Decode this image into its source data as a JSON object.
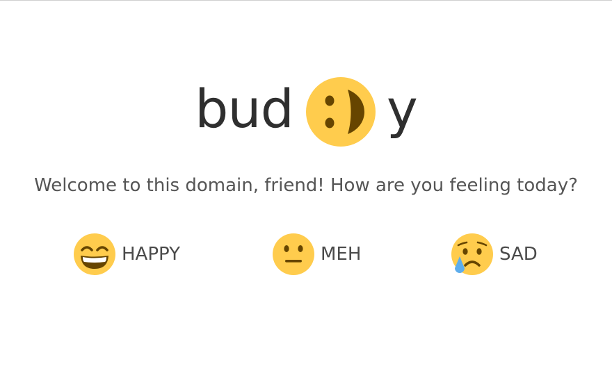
{
  "logo": {
    "left_text": "bud",
    "right_text": "y",
    "face_icon": "winking-smile-face-icon"
  },
  "greeting": "Welcome to this domain, friend! How are you feeling today?",
  "moods": [
    {
      "label": "HAPPY",
      "icon": "grinning-face-icon"
    },
    {
      "label": "MEH",
      "icon": "neutral-face-icon"
    },
    {
      "label": "SAD",
      "icon": "crying-face-icon"
    }
  ],
  "colors": {
    "face_yellow": "#FFCC4D",
    "feature_brown": "#664500",
    "tear_blue": "#5DADEC",
    "text_dark": "#2f2f2f",
    "text_gray": "#555555"
  }
}
